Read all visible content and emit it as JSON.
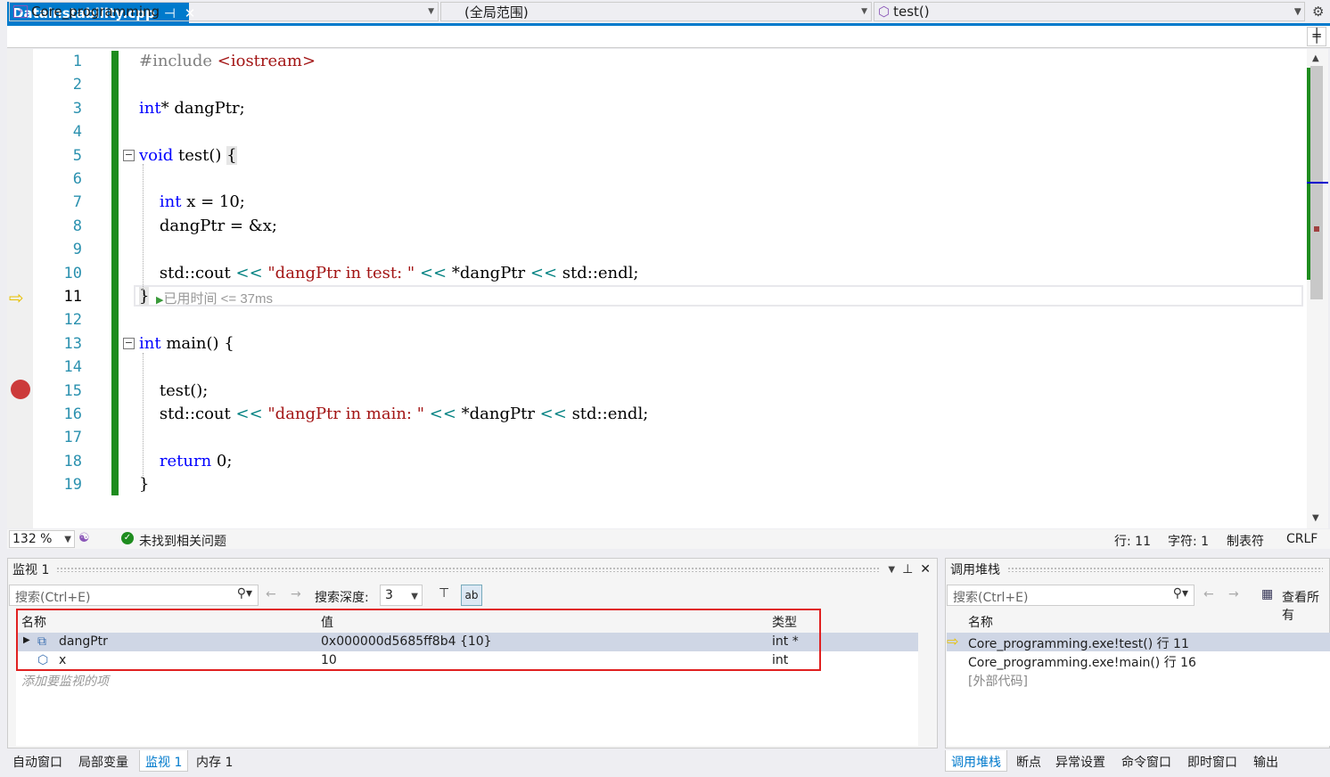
{
  "tab": {
    "title": "Datainstability.cpp",
    "pin": "⊣",
    "close": "✕"
  },
  "nav": {
    "project": "Core_programming",
    "scope": "(全局范围)",
    "func": "test()"
  },
  "code_lines": [
    {
      "n": "1",
      "html": "<span class='pp'>#include </span><span class='inc'>&lt;iostream&gt;</span>"
    },
    {
      "n": "2",
      "html": ""
    },
    {
      "n": "3",
      "html": "<span class='kw'>int</span>* dangPtr;"
    },
    {
      "n": "4",
      "html": ""
    },
    {
      "n": "5",
      "html": "<span class='kw'>void</span> test() <span style='background:#e6e6e6'>{</span>"
    },
    {
      "n": "6",
      "html": ""
    },
    {
      "n": "7",
      "html": "    <span class='kw'>int</span> x = 10;"
    },
    {
      "n": "8",
      "html": "    dangPtr = &amp;x;"
    },
    {
      "n": "9",
      "html": ""
    },
    {
      "n": "10",
      "html": "    std::cout <span class='op'>&lt;&lt;</span> <span class='str'>\"dangPtr in test: \"</span> <span class='op'>&lt;&lt;</span> *dangPtr <span class='op'>&lt;&lt;</span> std::endl;"
    },
    {
      "n": "11",
      "html": "<span style='background:#e6e6e6'>}</span>"
    },
    {
      "n": "12",
      "html": ""
    },
    {
      "n": "13",
      "html": "<span class='kw'>int</span> main() {"
    },
    {
      "n": "14",
      "html": ""
    },
    {
      "n": "15",
      "html": "    test();"
    },
    {
      "n": "16",
      "html": "    std::cout <span class='op'>&lt;&lt;</span> <span class='str'>\"dangPtr in main: \"</span> <span class='op'>&lt;&lt;</span> *dangPtr <span class='op'>&lt;&lt;</span> std::endl;"
    },
    {
      "n": "17",
      "html": ""
    },
    {
      "n": "18",
      "html": "    <span class='kw'>return</span> 0;"
    },
    {
      "n": "19",
      "html": "}"
    }
  ],
  "perf_hint": "已用时间 <= 37ms",
  "status": {
    "zoom": "132 %",
    "issues": "未找到相关问题",
    "line": "行: 11",
    "char": "字符: 1",
    "tabs": "制表符",
    "eol": "CRLF"
  },
  "watch": {
    "title": "监视 1",
    "search": "搜索(Ctrl+E)",
    "depth_label": "搜索深度:",
    "depth": "3",
    "cols": [
      "名称",
      "值",
      "类型"
    ],
    "rows": [
      {
        "name": "dangPtr",
        "value": "0x000000d5685ff8b4 {10}",
        "type": "int *"
      },
      {
        "name": "x",
        "value": "10",
        "type": "int"
      }
    ],
    "add": "添加要监视的项"
  },
  "callstack": {
    "title": "调用堆栈",
    "search": "搜索(Ctrl+E)",
    "view_all": "查看所有",
    "col": "名称",
    "rows": [
      "Core_programming.exe!test() 行 11",
      "Core_programming.exe!main() 行 16",
      "[外部代码]"
    ]
  },
  "bottom_tabs_left": [
    "自动窗口",
    "局部变量",
    "监视 1",
    "内存 1"
  ],
  "bottom_tabs_right": [
    "调用堆栈",
    "断点",
    "异常设置",
    "命令窗口",
    "即时窗口",
    "输出"
  ],
  "colors": {
    "accent": "#007acc",
    "change_bar": "#1e8c1e",
    "breakpoint": "#cc3a3a",
    "highlight_box": "#e02020"
  }
}
